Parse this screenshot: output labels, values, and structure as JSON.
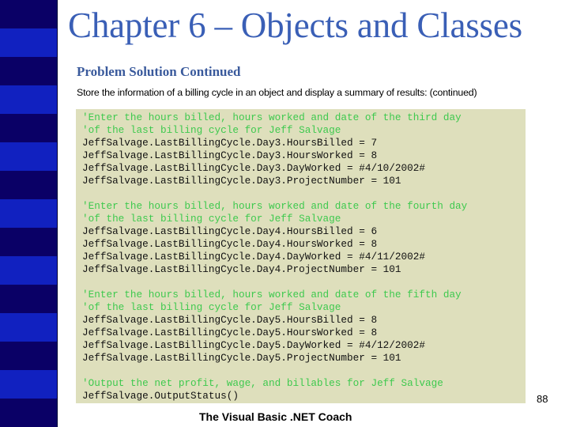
{
  "slide": {
    "title": "Chapter 6 – Objects and Classes",
    "subtitle": "Problem Solution Continued",
    "description": "Store the information of a billing cycle in an object and display a summary of results: (continued)",
    "page_number": "88",
    "footer": "The Visual Basic .NET Coach"
  },
  "colors": {
    "title": "#3a5fb6",
    "sidebar_dark": "#0a0066",
    "sidebar_light": "#1121c0",
    "code_background": "#dedfbc",
    "comment": "#3ec94e"
  },
  "sidebar": {
    "bands": [
      "dark",
      "light",
      "dark",
      "light",
      "dark",
      "light",
      "dark",
      "light",
      "dark",
      "light",
      "dark",
      "light",
      "dark",
      "light",
      "dark"
    ]
  },
  "code": {
    "blocks": [
      {
        "lines": [
          {
            "text": "'Enter the hours billed, hours worked and date of the third day",
            "comment": true
          },
          {
            "text": "'of the last billing cycle for Jeff Salvage",
            "comment": true
          },
          {
            "text": "JeffSalvage.LastBillingCycle.Day3.HoursBilled = 7",
            "comment": false
          },
          {
            "text": "JeffSalvage.LastBillingCycle.Day3.HoursWorked = 8",
            "comment": false
          },
          {
            "text": "JeffSalvage.LastBillingCycle.Day3.DayWorked = #4/10/2002#",
            "comment": false
          },
          {
            "text": "JeffSalvage.LastBillingCycle.Day3.ProjectNumber = 101",
            "comment": false
          }
        ]
      },
      {
        "lines": [
          {
            "text": "'Enter the hours billed, hours worked and date of the fourth day",
            "comment": true
          },
          {
            "text": "'of the last billing cycle for Jeff Salvage",
            "comment": true
          },
          {
            "text": "JeffSalvage.LastBillingCycle.Day4.HoursBilled = 6",
            "comment": false
          },
          {
            "text": "JeffSalvage.LastBillingCycle.Day4.HoursWorked = 8",
            "comment": false
          },
          {
            "text": "JeffSalvage.LastBillingCycle.Day4.DayWorked = #4/11/2002#",
            "comment": false
          },
          {
            "text": "JeffSalvage.LastBillingCycle.Day4.ProjectNumber = 101",
            "comment": false
          }
        ]
      },
      {
        "lines": [
          {
            "text": "'Enter the hours billed, hours worked and date of the fifth day",
            "comment": true
          },
          {
            "text": "'of the last billing cycle for Jeff Salvage",
            "comment": true
          },
          {
            "text": "JeffSalvage.LastBillingCycle.Day5.HoursBilled = 8",
            "comment": false
          },
          {
            "text": "JeffSalvage.LastBillingCycle.Day5.HoursWorked = 8",
            "comment": false
          },
          {
            "text": "JeffSalvage.LastBillingCycle.Day5.DayWorked = #4/12/2002#",
            "comment": false
          },
          {
            "text": "JeffSalvage.LastBillingCycle.Day5.ProjectNumber = 101",
            "comment": false
          }
        ]
      },
      {
        "lines": [
          {
            "text": "'Output the net profit, wage, and billables for Jeff Salvage",
            "comment": true
          },
          {
            "text": "JeffSalvage.OutputStatus()",
            "comment": false
          }
        ]
      }
    ]
  }
}
